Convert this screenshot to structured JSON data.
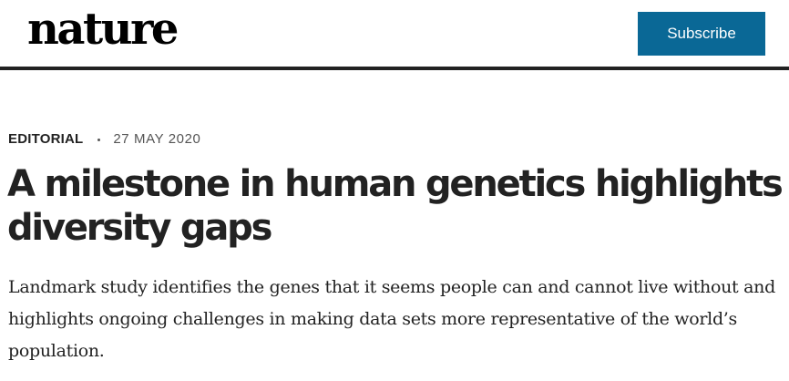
{
  "header": {
    "logo_text": "nature",
    "subscribe_label": "Subscribe"
  },
  "article": {
    "type": "EDITORIAL",
    "date": "27 MAY 2020",
    "title": "A milestone in human genetics highlights diversity gaps",
    "standfirst": "Landmark study identifies the genes that it seems people can and cannot live without and highlights ongoing challenges in making data sets more representative of the world’s population."
  },
  "colors": {
    "accent": "#0a6896",
    "text": "#222222",
    "rule": "#222222"
  }
}
